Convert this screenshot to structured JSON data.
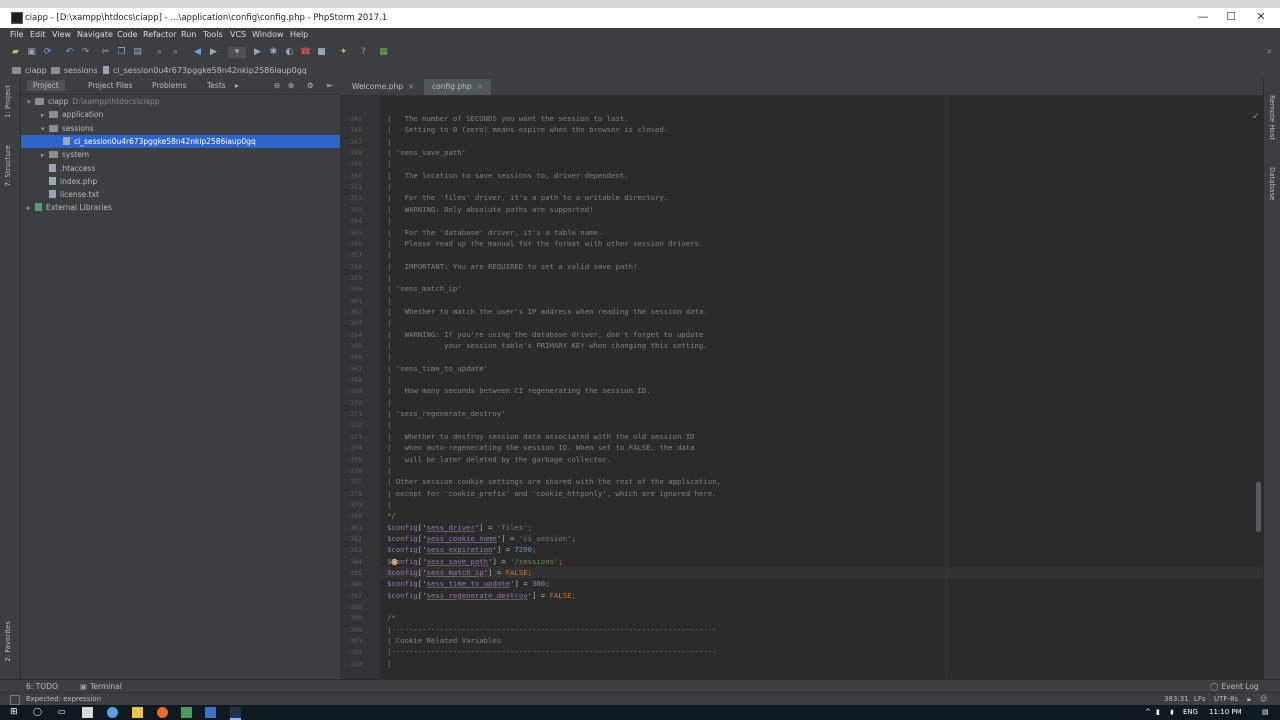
{
  "window": {
    "title": "ciapp - [D:\\xampp\\htdocs\\ciapp] - ...\\application\\config\\config.php - PhpStorm 2017.1",
    "controls": [
      "—",
      "☐",
      "✕"
    ]
  },
  "menu": [
    "File",
    "Edit",
    "View",
    "Navigate",
    "Code",
    "Refactor",
    "Run",
    "Tools",
    "VCS",
    "Window",
    "Help"
  ],
  "breadcrumb": [
    "ciapp",
    "sessions",
    "ci_session0u4r673pggke58n42nkip2586iaup0gq"
  ],
  "left_strip": {
    "project": "1: Project",
    "structure": "7: Structure",
    "favorites": "2: Favorites"
  },
  "right_strip": {
    "remote": "Remote Host",
    "database": "Database"
  },
  "project_panel": {
    "tabs": [
      "Project",
      "Project Files",
      "Problems",
      "Tests"
    ],
    "tree": [
      {
        "label": "ciapp",
        "hint": "D:\\xampp\\htdocs\\ciapp",
        "depth": 0,
        "arrow": "▾",
        "kind": "folder"
      },
      {
        "label": "application",
        "hint": "",
        "depth": 1,
        "arrow": "▸",
        "kind": "folder"
      },
      {
        "label": "sessions",
        "hint": "",
        "depth": 1,
        "arrow": "▾",
        "kind": "folder"
      },
      {
        "label": "ci_session0u4r673pggke58n42nkip2586iaup0gq",
        "hint": "",
        "depth": 2,
        "arrow": "",
        "kind": "file",
        "selected": true
      },
      {
        "label": "system",
        "hint": "",
        "depth": 1,
        "arrow": "▸",
        "kind": "folder"
      },
      {
        "label": ".htaccess",
        "hint": "",
        "depth": 1,
        "arrow": "",
        "kind": "file"
      },
      {
        "label": "index.php",
        "hint": "",
        "depth": 1,
        "arrow": "",
        "kind": "file"
      },
      {
        "label": "license.txt",
        "hint": "",
        "depth": 1,
        "arrow": "",
        "kind": "file"
      },
      {
        "label": "External Libraries",
        "hint": "",
        "depth": 0,
        "arrow": "▸",
        "kind": "ext"
      }
    ]
  },
  "editor": {
    "tabs": [
      {
        "label": "Welcome.php",
        "active": false
      },
      {
        "label": "config.php",
        "active": true
      }
    ],
    "lines": [
      {
        "n": "345",
        "t": "c",
        "s": "|   The number of SECONDS you want the session to last."
      },
      {
        "n": "346",
        "t": "c",
        "s": "|   Setting to 0 (zero) means expire when the browser is closed."
      },
      {
        "n": "347",
        "t": "c",
        "s": "|"
      },
      {
        "n": "348",
        "t": "c",
        "s": "| 'sess_save_path'"
      },
      {
        "n": "349",
        "t": "c",
        "s": "|"
      },
      {
        "n": "350",
        "t": "c",
        "s": "|   The location to save sessions to, driver dependent."
      },
      {
        "n": "351",
        "t": "c",
        "s": "|"
      },
      {
        "n": "352",
        "t": "c",
        "s": "|   For the 'files' driver, it's a path to a writable directory."
      },
      {
        "n": "353",
        "t": "c",
        "s": "|   WARNING: Only absolute paths are supported!"
      },
      {
        "n": "354",
        "t": "c",
        "s": "|"
      },
      {
        "n": "355",
        "t": "c",
        "s": "|   For the 'database' driver, it's a table name."
      },
      {
        "n": "356",
        "t": "c",
        "s": "|   Please read up the manual for the format with other session drivers."
      },
      {
        "n": "357",
        "t": "c",
        "s": "|"
      },
      {
        "n": "358",
        "t": "c",
        "s": "|   IMPORTANT: You are REQUIRED to set a valid save path!"
      },
      {
        "n": "359",
        "t": "c",
        "s": "|"
      },
      {
        "n": "360",
        "t": "c",
        "s": "| 'sess_match_ip'"
      },
      {
        "n": "361",
        "t": "c",
        "s": "|"
      },
      {
        "n": "362",
        "t": "c",
        "s": "|   Whether to match the user's IP address when reading the session data."
      },
      {
        "n": "363",
        "t": "c",
        "s": "|"
      },
      {
        "n": "364",
        "t": "c",
        "s": "|   WARNING: If you're using the database driver, don't forget to update"
      },
      {
        "n": "365",
        "t": "c",
        "s": "|            your session table's PRIMARY KEY when changing this setting."
      },
      {
        "n": "366",
        "t": "c",
        "s": "|"
      },
      {
        "n": "367",
        "t": "c",
        "s": "| 'sess_time_to_update'"
      },
      {
        "n": "368",
        "t": "c",
        "s": "|"
      },
      {
        "n": "369",
        "t": "c",
        "s": "|   How many seconds between CI regenerating the session ID."
      },
      {
        "n": "370",
        "t": "c",
        "s": "|"
      },
      {
        "n": "371",
        "t": "c",
        "s": "| 'sess_regenerate_destroy'"
      },
      {
        "n": "372",
        "t": "c",
        "s": "|"
      },
      {
        "n": "373",
        "t": "c",
        "s": "|   Whether to destroy session data associated with the old session ID"
      },
      {
        "n": "374",
        "t": "c",
        "s": "|   when auto-regenerating the session ID. When set to FALSE, the data"
      },
      {
        "n": "375",
        "t": "c",
        "s": "|   will be later deleted by the garbage collector."
      },
      {
        "n": "376",
        "t": "c",
        "s": "|"
      },
      {
        "n": "377",
        "t": "c",
        "s": "| Other session cookie settings are shared with the rest of the application,"
      },
      {
        "n": "378",
        "t": "c",
        "s": "| except for 'cookie_prefix' and 'cookie_httponly', which are ignored here."
      },
      {
        "n": "379",
        "t": "c",
        "s": "|"
      },
      {
        "n": "380",
        "t": "c",
        "s": "*/"
      },
      {
        "n": "381",
        "t": "cfg",
        "k": "sess_driver",
        "v": "'files'",
        "vt": "str"
      },
      {
        "n": "382",
        "t": "cfg",
        "k": "sess_cookie_name",
        "v": "'ci_session'",
        "vt": "str"
      },
      {
        "n": "383",
        "t": "cfg",
        "k": "sess_expiration",
        "v": "7200",
        "vt": "num"
      },
      {
        "n": "384",
        "t": "cfg",
        "k": "sess_save_path",
        "v": "'/sessions'",
        "vt": "str"
      },
      {
        "n": "385",
        "t": "cfg",
        "k": "sess_match_ip",
        "v": "FALSE",
        "vt": "kw"
      },
      {
        "n": "386",
        "t": "cfg",
        "k": "sess_time_to_update",
        "v": "300",
        "vt": "num"
      },
      {
        "n": "387",
        "t": "cfg",
        "k": "sess_regenerate_destroy",
        "v": "FALSE",
        "vt": "kw"
      },
      {
        "n": "388",
        "t": "c",
        "s": ""
      },
      {
        "n": "389",
        "t": "c",
        "s": "/*"
      },
      {
        "n": "390",
        "t": "c",
        "s": "|--------------------------------------------------------------------------"
      },
      {
        "n": "391",
        "t": "c",
        "s": "| Cookie Related Variables"
      },
      {
        "n": "392",
        "t": "c",
        "s": "|--------------------------------------------------------------------------"
      },
      {
        "n": "393",
        "t": "c",
        "s": "|"
      }
    ]
  },
  "bottom_tools": {
    "todo": "6: TODO",
    "terminal": "Terminal",
    "event_log": "Event Log"
  },
  "status": {
    "message": "Expected: expression",
    "position": "383:31",
    "line_sep": "LFs",
    "encoding": "UTF-8s"
  },
  "taskbar": {
    "lang": "ENG",
    "time": "11:10 PM"
  },
  "colors": {
    "accent": "#2f65ca",
    "keyword": "#cc7832",
    "string": "#6a8759",
    "variable": "#9876aa"
  }
}
